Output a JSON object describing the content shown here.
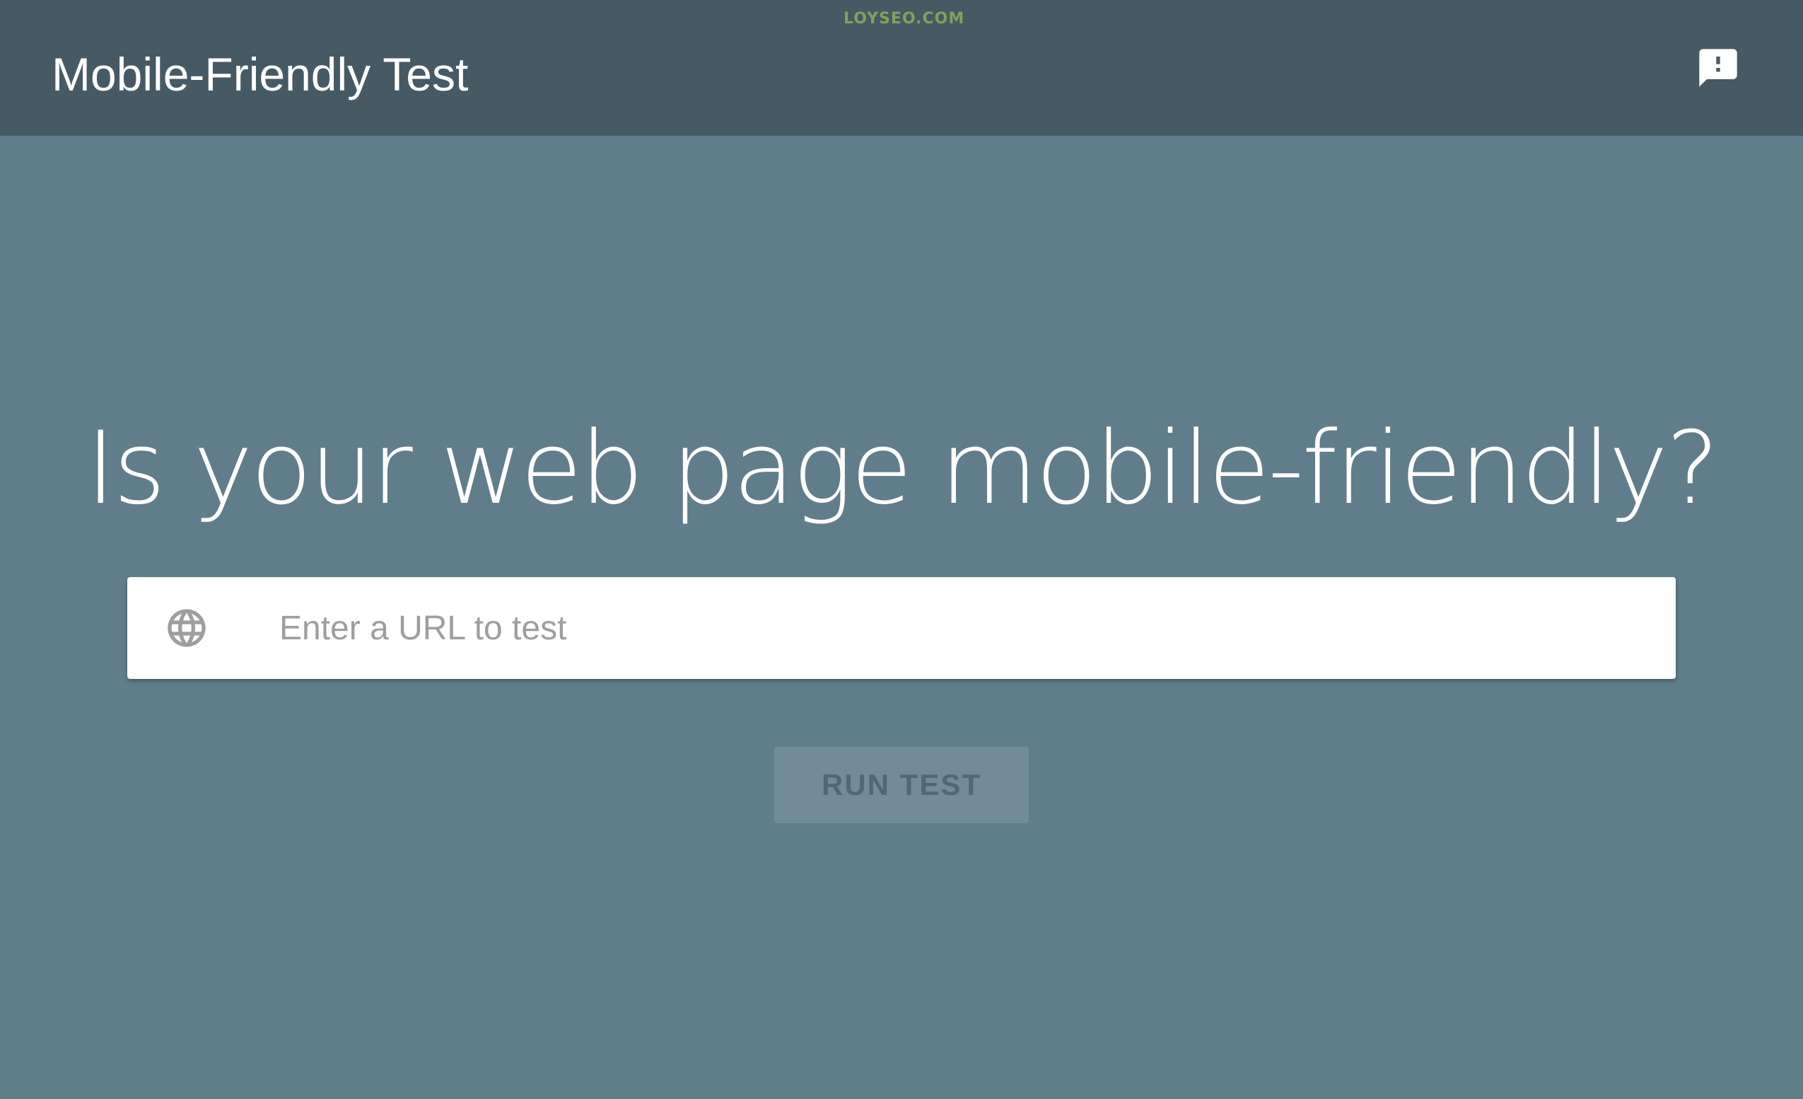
{
  "app": {
    "title": "Mobile-Friendly Test",
    "watermark": "LOYSEO.COM"
  },
  "header": {
    "feedback_icon": "feedback-icon"
  },
  "main": {
    "headline": "Is your web page mobile-friendly?",
    "url_input": {
      "placeholder": "Enter a URL to test",
      "value": "",
      "icon": "globe-icon"
    },
    "run_button_label": "RUN TEST"
  },
  "colors": {
    "app_bar": "#455a64",
    "background": "#607d8b",
    "button_disabled": "#718c98",
    "button_text_disabled": "#4f6874",
    "placeholder": "#9e9e9e"
  }
}
